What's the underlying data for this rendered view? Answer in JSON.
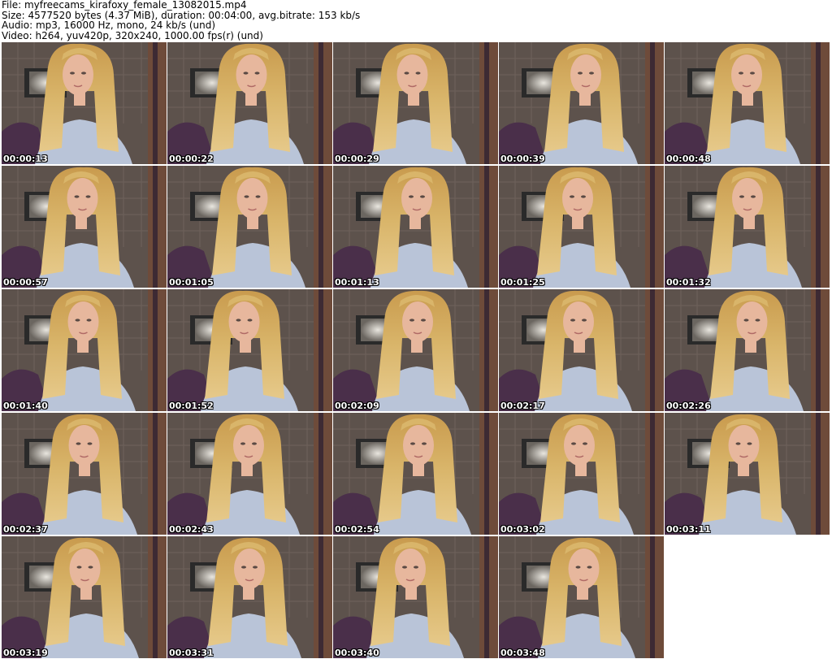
{
  "header": {
    "file": "File: myfreecams_kirafoxy_female_13082015.mp4",
    "size": "Size: 4577520 bytes (4.37 MiB), duration: 00:04:00, avg.bitrate: 153 kb/s",
    "audio": "Audio: mp3, 16000 Hz, mono, 24 kb/s (und)",
    "video": "Video: h264, yuv420p, 320x240, 1000.00 fps(r) (und)"
  },
  "timestamps": [
    "00:00:13",
    "00:00:22",
    "00:00:29",
    "00:00:39",
    "00:00:48",
    "00:00:57",
    "00:01:05",
    "00:01:13",
    "00:01:25",
    "00:01:32",
    "00:01:40",
    "00:01:52",
    "00:02:09",
    "00:02:17",
    "00:02:26",
    "00:02:37",
    "00:02:43",
    "00:02:54",
    "00:03:02",
    "00:03:11",
    "00:03:19",
    "00:03:31",
    "00:03:40",
    "00:03:48"
  ],
  "colors": {
    "wall": "#5d524c",
    "hair": "#d9b56a",
    "skin": "#e7b79d",
    "shirt": "#b9c4d8",
    "purple": "#4a2f4a",
    "screen": "#2a2a2a",
    "glow": "#e9e6df"
  }
}
